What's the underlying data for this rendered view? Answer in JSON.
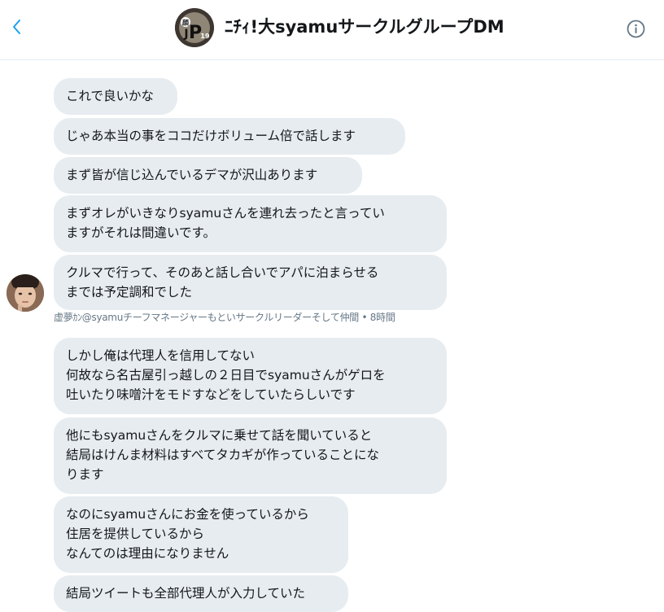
{
  "header": {
    "title": "ﾆﾁｨ!大syamuサークルグループDM",
    "avatar_text": "JP 19",
    "icons": {
      "back": "chevron-left-icon",
      "info": "info-circle-icon"
    },
    "accent_color": "#1da1f2"
  },
  "messages": [
    {
      "text": "これで良いかな"
    },
    {
      "text": "じゃあ本当の事をココだけボリューム倍で話します"
    },
    {
      "text": "まず皆が信じ込んでいるデマが沢山あります"
    },
    {
      "text": "まずオレがいきなりsyamuさんを連れ去ったと言ってい\nますがそれは間違いです。"
    },
    {
      "text": "クルマで行って、そのあと話し合いでアパに泊まらせる\nまでは予定調和でした"
    },
    {
      "text": "しかし俺は代理人を信用してない\n何故なら名古屋引っ越しの２日目でsyamuさんがゲロを\n吐いたり味噌汁をモドすなどをしていたらしいです"
    },
    {
      "text": "他にもsyamuさんをクルマに乗せて話を聞いていると\n結局はけんま材料はすべてタカギが作っていることにな\nります"
    },
    {
      "text": "なのにsyamuさんにお金を使っているから\n住居を提供しているから\nなんてのは理由になりません"
    },
    {
      "text": "結局ツイートも全部代理人が入力していた"
    }
  ],
  "sender_meta": "虚夢ｶﾝ@syamuチーフマネージャーもといサークルリーダーそして仲間 • 8時間",
  "bubble_color": "#e6ecf0"
}
